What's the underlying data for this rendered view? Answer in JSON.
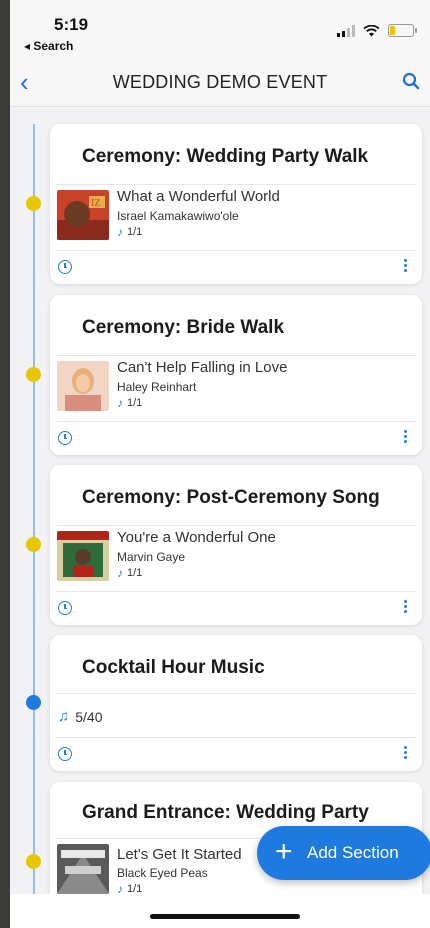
{
  "status_bar": {
    "time": "5:19",
    "back_app": "◂ Search"
  },
  "nav": {
    "title": "WEDDING DEMO EVENT"
  },
  "sections": [
    {
      "title": "Ceremony: Wedding Party Walk",
      "song": "What a Wonderful World",
      "artist": "Israel Kamakawiwo'ole",
      "count": "1/1",
      "dot_color": "#e6c700"
    },
    {
      "title": "Ceremony: Bride Walk",
      "song": "Can't Help Falling in Love",
      "artist": "Haley Reinhart",
      "count": "1/1",
      "dot_color": "#e6c700"
    },
    {
      "title": "Ceremony: Post-Ceremony Song",
      "song": "You're a Wonderful One",
      "artist": "Marvin Gaye",
      "count": "1/1",
      "dot_color": "#e6c700"
    },
    {
      "title": "Cocktail Hour Music",
      "count": "5/40",
      "dot_color": "#1f7ae0"
    },
    {
      "title": "Grand Entrance: Wedding Party",
      "song": "Let's Get It Started",
      "artist": "Black Eyed Peas",
      "count": "1/1",
      "dot_color": "#e6c700"
    }
  ],
  "fab": {
    "label": "Add Section"
  },
  "colors": {
    "accent": "#1f7ae0",
    "timeline": "#8fbef0",
    "dot_pending": "#e6c700"
  }
}
